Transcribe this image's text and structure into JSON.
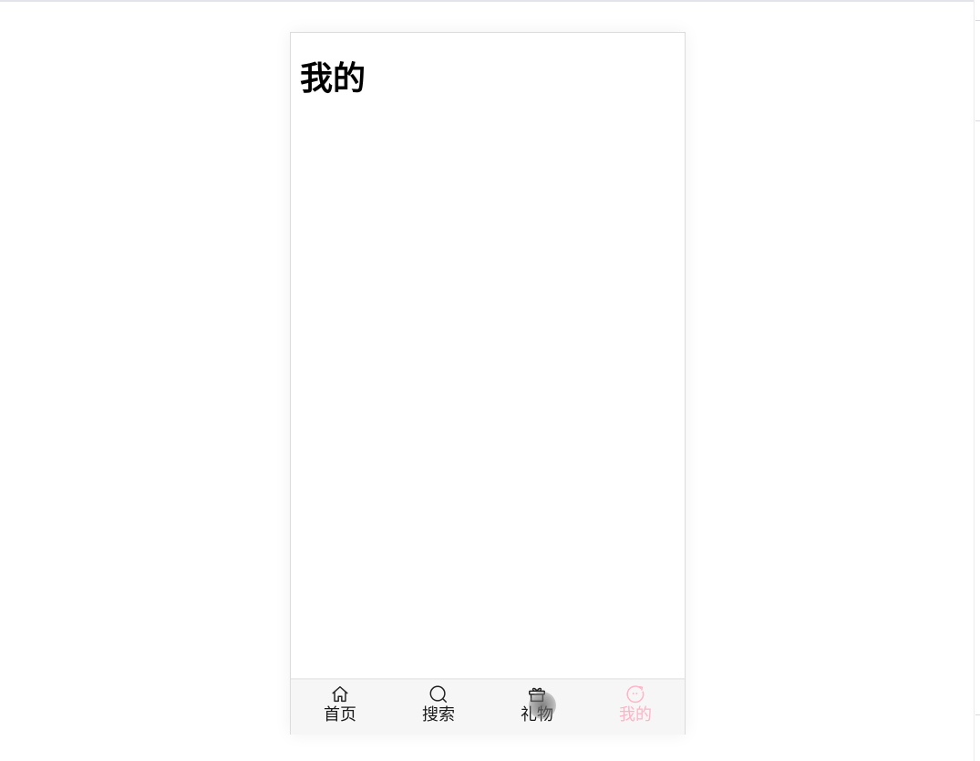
{
  "page": {
    "title": "我的"
  },
  "tabbar": {
    "active_color": "#ffb3c6",
    "tabs": [
      {
        "label": "首页",
        "icon": "home-icon"
      },
      {
        "label": "搜索",
        "icon": "search-icon"
      },
      {
        "label": "礼物",
        "icon": "gift-icon"
      },
      {
        "label": "我的",
        "icon": "profile-face-icon",
        "active": true
      }
    ]
  }
}
